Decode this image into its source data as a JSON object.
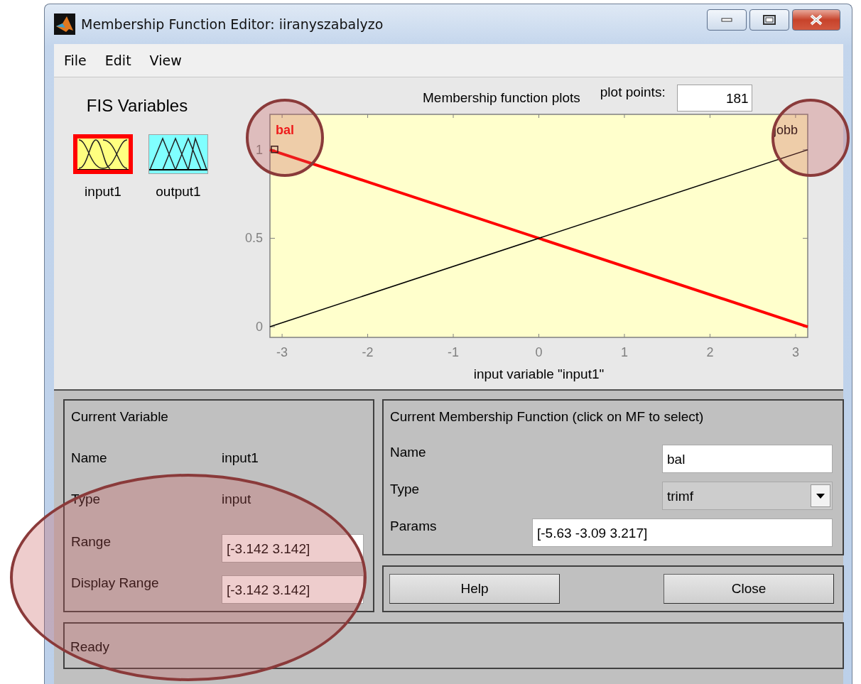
{
  "window": {
    "title": "Membership Function Editor: iiranyszabalyzo"
  },
  "menu": [
    "File",
    "Edit",
    "View"
  ],
  "fis_variables": {
    "title": "FIS Variables",
    "items": [
      {
        "label": "input1",
        "kind": "input",
        "selected": true
      },
      {
        "label": "output1",
        "kind": "output",
        "selected": false
      }
    ]
  },
  "plot": {
    "title": "Membership function plots",
    "plot_points_label": "plot points:",
    "plot_points": "181",
    "curves": [
      {
        "selected": true
      },
      {
        "selected": false
      }
    ],
    "chart_data": {
      "type": "line",
      "xlabel": "input variable \"input1\"",
      "x": [
        -3.142,
        3.142
      ],
      "xlim": [
        -3.142,
        3.142
      ],
      "ylim": [
        -0.06,
        1.2
      ],
      "xticks": [
        -3,
        -2,
        -1,
        0,
        1,
        2,
        3
      ],
      "yticks": [
        0,
        0.5,
        1
      ],
      "series": [
        {
          "name": "bal",
          "color": "#ff0000",
          "values": [
            1,
            0
          ]
        },
        {
          "name": "jobb",
          "color": "#000000",
          "values": [
            0,
            1
          ]
        }
      ]
    }
  },
  "current_variable": {
    "title": "Current Variable",
    "name_label": "Name",
    "name": "input1",
    "type_label": "Type",
    "type": "input",
    "range_label": "Range",
    "range": "[-3.142 3.142]",
    "display_range_label": "Display Range",
    "display_range": "[-3.142 3.142]"
  },
  "current_mf": {
    "title": "Current Membership Function (click on MF to select)",
    "name_label": "Name",
    "name": "bal",
    "type_label": "Type",
    "type": "trimf",
    "params_label": "Params",
    "params": "[-5.63 -3.09 3.217]"
  },
  "buttons": [
    "Help",
    "Close"
  ],
  "status": "Ready"
}
